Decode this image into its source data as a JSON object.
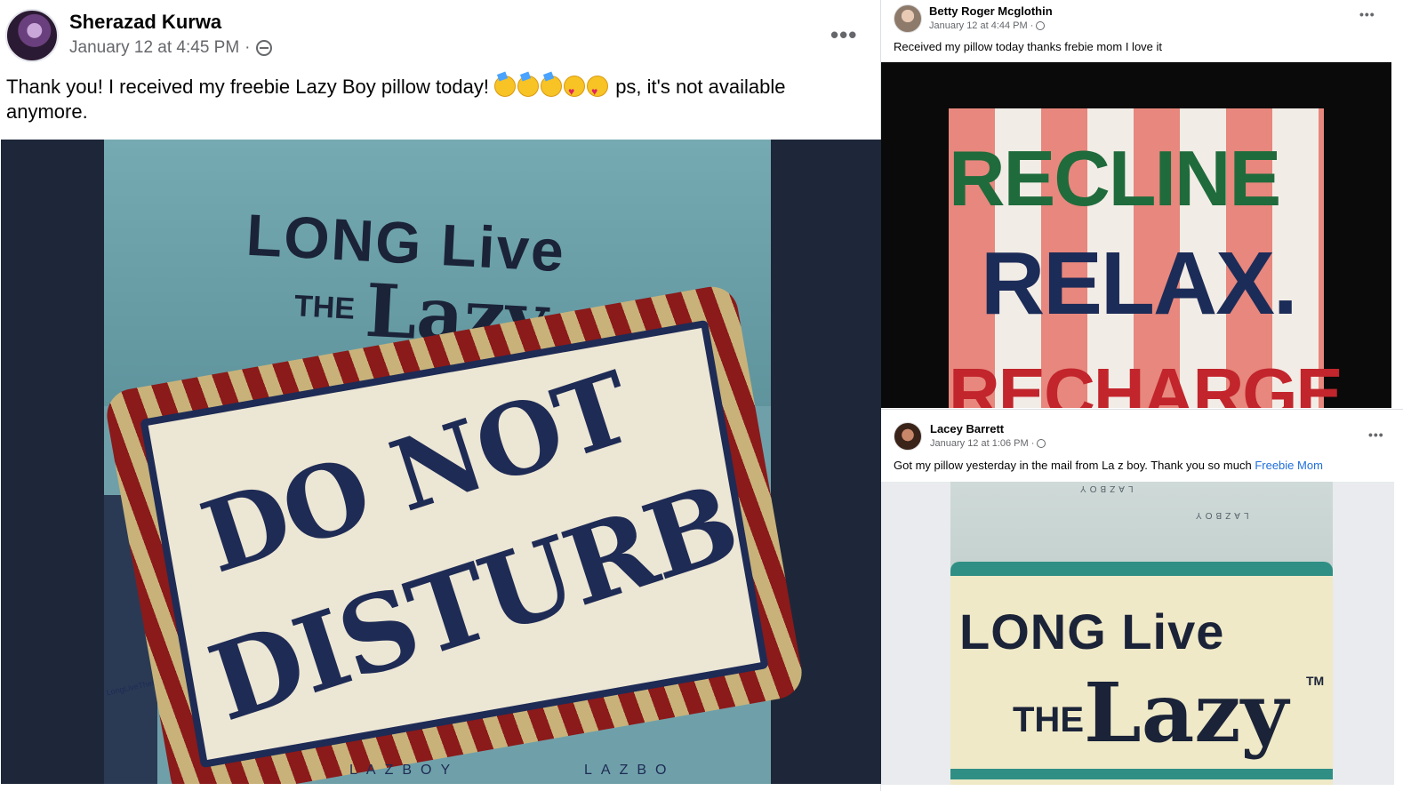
{
  "posts": [
    {
      "author": "Sherazad Kurwa",
      "timestamp": "January 12 at 4:45 PM",
      "separator": "·",
      "text_before": "Thank you! I received my freebie Lazy Boy pillow today!",
      "text_after": "ps, it's not available anymore.",
      "more_label": "•••",
      "photo": {
        "box_line1": "LONG Live",
        "box_line2": "THE",
        "box_line3": "Lazy",
        "pillow_line1": "DO NOT",
        "pillow_line2": "DISTURB",
        "brand": "LAZBOY",
        "brand2": "LAZBO",
        "side_label": "LongLiveTheLazy"
      }
    },
    {
      "author": "Betty Roger Mcglothin",
      "timestamp": "January 12 at 4:44 PM",
      "separator": "·",
      "text": "Received my pillow today thanks frebie mom I love it",
      "more_label": "•••",
      "photo": {
        "line1": "RECLINE",
        "line2": "RELAX.",
        "line3": "RECHARGE"
      }
    },
    {
      "author": "Lacey Barrett",
      "timestamp": "January 12 at 1:06 PM",
      "separator": "·",
      "text": "Got my pillow yesterday in the mail from La z boy. Thank you so much",
      "link": "Freebie Mom",
      "more_label": "•••",
      "photo": {
        "line1": "LONG Live",
        "line2": "THE",
        "line3": "Lazy",
        "tm": "TM",
        "brand": "LAZBOY"
      }
    }
  ]
}
